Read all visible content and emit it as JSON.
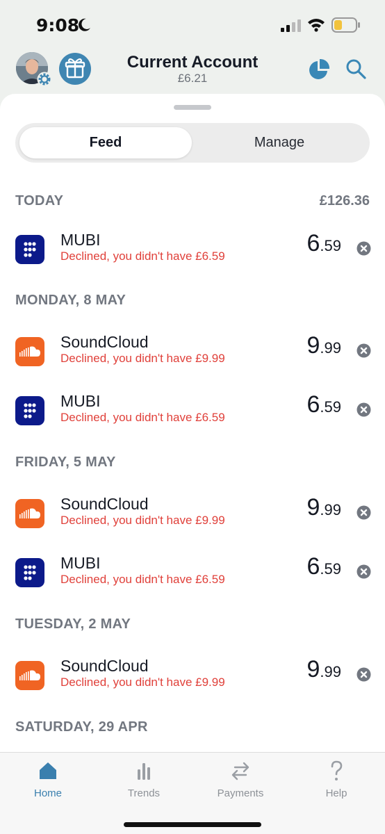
{
  "status_bar": {
    "time": "9:08",
    "icons": [
      "moon-icon",
      "cellular-signal-icon",
      "wifi-icon",
      "battery-icon"
    ],
    "battery_color": "#f2c33d"
  },
  "header": {
    "title": "Current Account",
    "balance": "£6.21",
    "icons": [
      "avatar",
      "settings-icon",
      "gift-icon",
      "pie-chart-icon",
      "search-icon"
    ],
    "accent_color": "#3f86b2"
  },
  "segmented_control": {
    "feed_label": "Feed",
    "manage_label": "Manage",
    "selected": "Feed"
  },
  "sections": [
    {
      "label": "TODAY",
      "total": "£126.36",
      "transactions": [
        {
          "merchant": "MUBI",
          "status": "Declined, you didn't have £6.59",
          "amount_major": "6",
          "amount_minor": ".59",
          "logo": "mubi-logo"
        }
      ]
    },
    {
      "label": "MONDAY, 8 MAY",
      "total": "",
      "transactions": [
        {
          "merchant": "SoundCloud",
          "status": "Declined, you didn't have £9.99",
          "amount_major": "9",
          "amount_minor": ".99",
          "logo": "soundcloud-logo"
        },
        {
          "merchant": "MUBI",
          "status": "Declined, you didn't have £6.59",
          "amount_major": "6",
          "amount_minor": ".59",
          "logo": "mubi-logo"
        }
      ]
    },
    {
      "label": "FRIDAY, 5 MAY",
      "total": "",
      "transactions": [
        {
          "merchant": "SoundCloud",
          "status": "Declined, you didn't have £9.99",
          "amount_major": "9",
          "amount_minor": ".99",
          "logo": "soundcloud-logo"
        },
        {
          "merchant": "MUBI",
          "status": "Declined, you didn't have £6.59",
          "amount_major": "6",
          "amount_minor": ".59",
          "logo": "mubi-logo"
        }
      ]
    },
    {
      "label": "TUESDAY, 2 MAY",
      "total": "",
      "transactions": [
        {
          "merchant": "SoundCloud",
          "status": "Declined, you didn't have £9.99",
          "amount_major": "9",
          "amount_minor": ".99",
          "logo": "soundcloud-logo"
        }
      ]
    },
    {
      "label": "SATURDAY, 29 APR",
      "total": "",
      "transactions": []
    }
  ],
  "colors": {
    "declined_text": "#e0403a",
    "mubi_brand": "#0c1a8a",
    "soundcloud_brand": "#f06423",
    "active_tab": "#3a7fae"
  },
  "tab_bar": {
    "tabs": [
      {
        "label": "Home",
        "icon": "home-icon",
        "active": true
      },
      {
        "label": "Trends",
        "icon": "bar-chart-icon",
        "active": false
      },
      {
        "label": "Payments",
        "icon": "transfer-arrows-icon",
        "active": false
      },
      {
        "label": "Help",
        "icon": "question-mark-icon",
        "active": false
      }
    ]
  }
}
